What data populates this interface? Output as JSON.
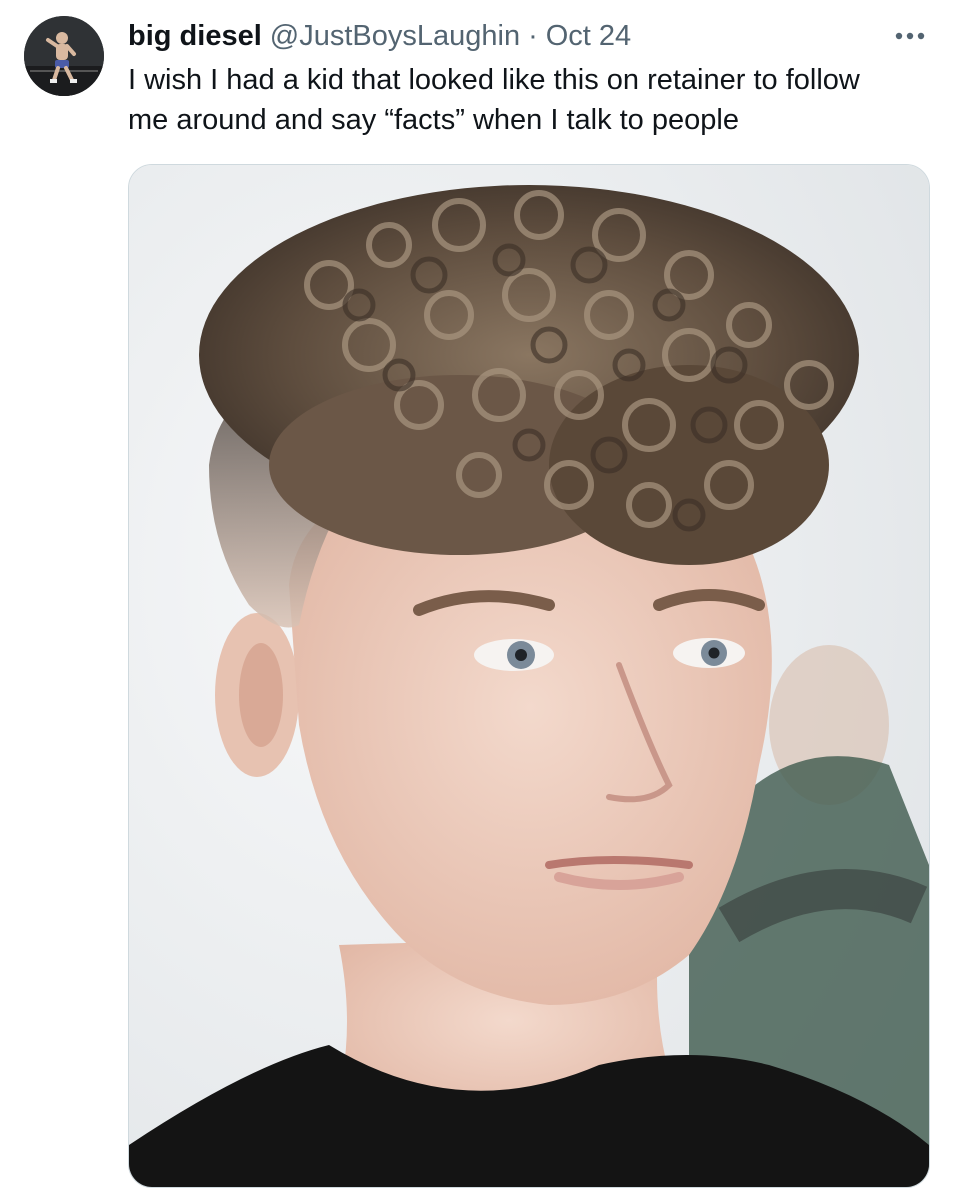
{
  "tweet": {
    "author": {
      "display_name": "big diesel",
      "handle": "@JustBoysLaughin",
      "separator": "·",
      "date": "Oct 24"
    },
    "text": "I wish I had a kid that looked like this on retainer to follow\nme around and say “facts” when I talk to people",
    "media": {
      "alt": "photo of a young man with a curly hair top and faded sides"
    }
  },
  "icons": {
    "more": "more-horizontal-icon"
  },
  "colors": {
    "text_primary": "#0f1419",
    "text_secondary": "#536471",
    "border": "#cfd9de"
  }
}
